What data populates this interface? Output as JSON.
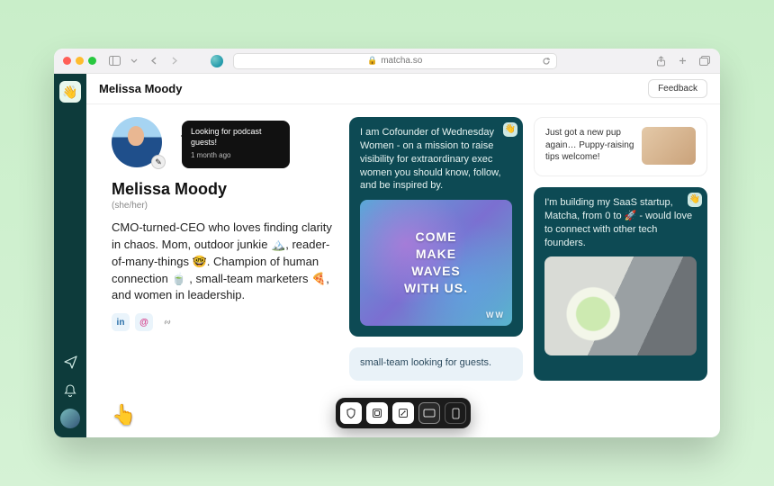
{
  "browser": {
    "url_host": "matcha.so",
    "tab_controls": {
      "sidebar": "sidebar",
      "back": "back",
      "forward": "forward",
      "share": "share",
      "add": "add",
      "tabs": "tabs"
    }
  },
  "rail": {
    "logo_emoji": "👋",
    "bottom_icons": {
      "send": "send",
      "bell": "notifications"
    }
  },
  "header": {
    "title": "Melissa Moody",
    "feedback_label": "Feedback"
  },
  "profile": {
    "status": {
      "text": "Looking for podcast guests!",
      "ago": "1 month ago"
    },
    "name": "Melissa Moody",
    "pronouns": "(she/her)",
    "bio": "CMO-turned-CEO who loves finding clarity in chaos. Mom, outdoor junkie 🏔️, reader-of-many-things 🤓. Champion of human connection 🍵 , small-team marketers 🍕, and women in leadership.",
    "socials": {
      "linkedin": "in",
      "instagram": "@"
    }
  },
  "cards": {
    "cofounder": {
      "text": "I am Cofounder of Wednesday Women - on a mission to raise visibility for extraordinary exec women you should know, follow, and be inspired by.",
      "image_overlay": "COME\nMAKE\nWAVES\nWITH US.",
      "image_badge": "WW"
    },
    "pup": {
      "text": "Just got a new pup again… Puppy-raising tips welcome!"
    },
    "saas": {
      "text": "I'm building my SaaS startup, Matcha, from 0 to 🚀 - would love to connect with other tech founders."
    },
    "podcast": {
      "text": "small-team looking for guests."
    }
  },
  "floatbar": {
    "items": [
      "shield",
      "card-square",
      "expand",
      "card-wide",
      "phone"
    ]
  }
}
